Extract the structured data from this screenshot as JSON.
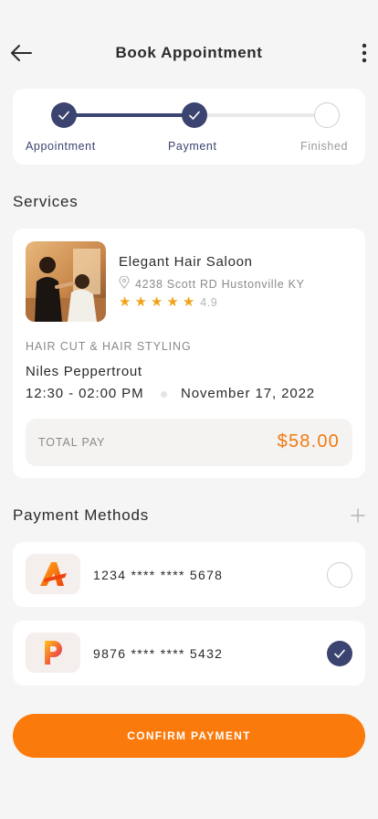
{
  "header": {
    "title": "Book Appointment"
  },
  "stepper": {
    "steps": [
      {
        "label": "Appointment",
        "state": "done"
      },
      {
        "label": "Payment",
        "state": "done"
      },
      {
        "label": "Finished",
        "state": "pending"
      }
    ]
  },
  "services": {
    "section_title": "Services",
    "salon": {
      "name": "Elegant Hair Saloon",
      "address": "4238 Scott RD Hustonville KY",
      "rating": "4.9",
      "stars": 5
    },
    "service_type": "HAIR CUT & HAIR STYLING",
    "stylist": "Niles Peppertrout",
    "time": "12:30 - 02:00 PM",
    "date": "November 17, 2022",
    "total_label": "TOTAL PAY",
    "total_value": "$58.00"
  },
  "payment_methods": {
    "section_title": "Payment Methods",
    "cards": [
      {
        "number": "1234 **** **** 5678",
        "logo_letter": "A",
        "selected": false
      },
      {
        "number": "9876 **** **** 5432",
        "logo_letter": "P",
        "selected": true
      }
    ]
  },
  "confirm_button": {
    "label": "CONFIRM PAYMENT"
  },
  "colors": {
    "primary": "#3b4370",
    "accent": "#fb7a0c",
    "star": "#f4a21a"
  }
}
